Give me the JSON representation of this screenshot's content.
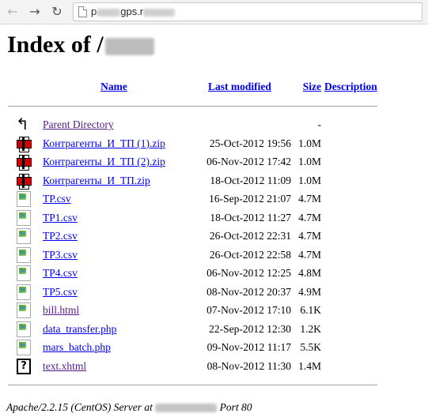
{
  "browser": {
    "back_icon": "arrow-left-icon",
    "forward_icon": "arrow-right-icon",
    "reload_icon": "reload-icon",
    "url_prefix": "p",
    "url_suffix": "gps.r"
  },
  "page": {
    "heading": "Index of /"
  },
  "listing": {
    "headers": {
      "name": "Name",
      "last_modified": "Last modified",
      "size": "Size",
      "description": "Description"
    },
    "rows": [
      {
        "icon": "parent-directory-icon",
        "name": "Parent Directory",
        "modified": "",
        "size": "-",
        "visited": true
      },
      {
        "icon": "archive-icon",
        "name": "Контрагенты_И_ТП (1).zip",
        "modified": "25-Oct-2012 19:56",
        "size": "1.0M"
      },
      {
        "icon": "archive-icon",
        "name": "Контрагенты_И_ТП (2).zip",
        "modified": "06-Nov-2012 17:42",
        "size": "1.0M"
      },
      {
        "icon": "archive-icon",
        "name": "Контрагенты_И_ТП.zip",
        "modified": "18-Oct-2012 11:09",
        "size": "1.0M"
      },
      {
        "icon": "broken-image-icon",
        "name": "TP.csv",
        "modified": "16-Sep-2012 21:07",
        "size": "4.7M"
      },
      {
        "icon": "broken-image-icon",
        "name": "TP1.csv",
        "modified": "18-Oct-2012 11:27",
        "size": "4.7M"
      },
      {
        "icon": "broken-image-icon",
        "name": "TP2.csv",
        "modified": "26-Oct-2012 22:31",
        "size": "4.7M"
      },
      {
        "icon": "broken-image-icon",
        "name": "TP3.csv",
        "modified": "26-Oct-2012 22:58",
        "size": "4.7M"
      },
      {
        "icon": "broken-image-icon",
        "name": "TP4.csv",
        "modified": "06-Nov-2012 12:25",
        "size": "4.8M"
      },
      {
        "icon": "broken-image-icon",
        "name": "TP5.csv",
        "modified": "08-Nov-2012 20:37",
        "size": "4.9M"
      },
      {
        "icon": "broken-image-icon",
        "name": "bill.html",
        "modified": "07-Nov-2012 17:10",
        "size": "6.1K",
        "visited": true
      },
      {
        "icon": "broken-image-icon",
        "name": "data_transfer.php",
        "modified": "22-Sep-2012 12:30",
        "size": "1.2K"
      },
      {
        "icon": "broken-image-icon",
        "name": "mars_batch.php",
        "modified": "09-Nov-2012 11:17",
        "size": "5.5K"
      },
      {
        "icon": "unknown-file-icon",
        "name": "text.xhtml",
        "modified": "08-Nov-2012 11:30",
        "size": "1.4M",
        "visited": true
      }
    ]
  },
  "footer": {
    "server": "Apache/2.2.15 (CentOS) Server at",
    "port": "Port 80"
  }
}
